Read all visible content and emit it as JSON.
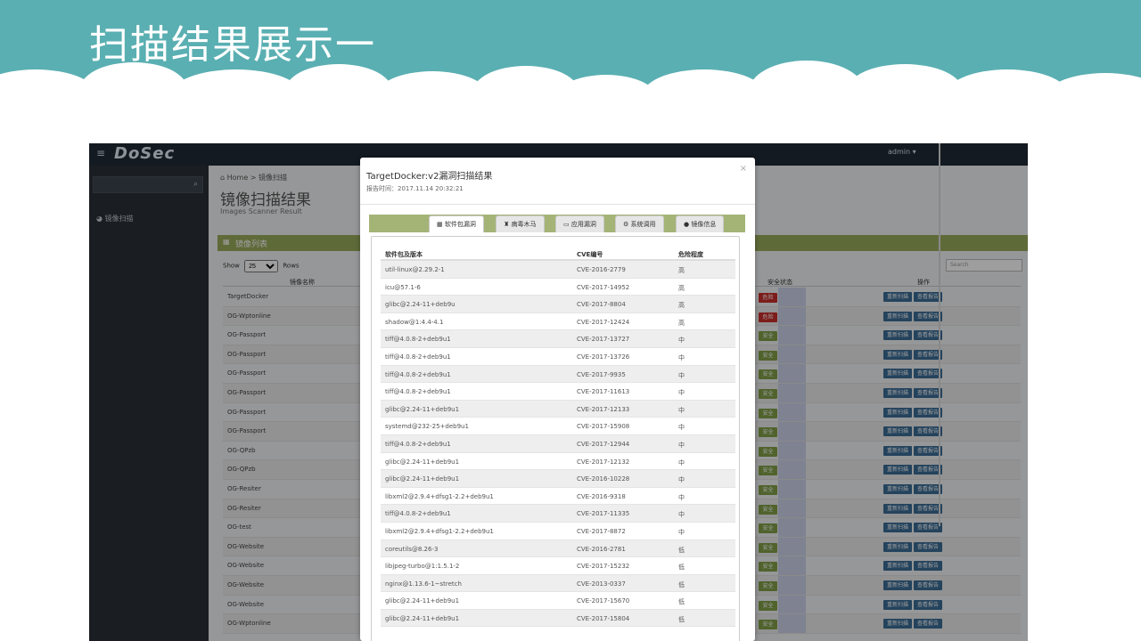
{
  "slide_title": "扫描结果展示一",
  "app": {
    "logo": "DoSec",
    "user": "admin ▾",
    "sidebar": {
      "search_placeholder": "Search...",
      "item": "镜像扫描"
    },
    "breadcrumb": {
      "home": "Home",
      "sep": ">",
      "current": "镜像扫描"
    },
    "page_title": "镜像扫描结果",
    "page_subtitle": "Images Scanner Result",
    "panel_title": "镜像列表",
    "show_label": "Show",
    "show_value": "25",
    "rows_label": "Rows",
    "search_placeholder": "Search",
    "columns": {
      "name": "镜像名称",
      "status": "安全状态",
      "ops": "操作"
    },
    "btn_rescan": "重新扫描",
    "btn_report": "查看报告",
    "images": [
      {
        "name": "TargetDocker",
        "status": "危险",
        "level": "danger"
      },
      {
        "name": "OG-Wptonline",
        "status": "危险",
        "level": "danger"
      },
      {
        "name": "OG-Passport",
        "status": "安全",
        "level": "safe"
      },
      {
        "name": "OG-Passport",
        "status": "安全",
        "level": "safe"
      },
      {
        "name": "OG-Passport",
        "status": "安全",
        "level": "safe"
      },
      {
        "name": "OG-Passport",
        "status": "安全",
        "level": "safe"
      },
      {
        "name": "OG-Passport",
        "status": "安全",
        "level": "safe"
      },
      {
        "name": "OG-Passport",
        "status": "安全",
        "level": "safe"
      },
      {
        "name": "OG-QPzb",
        "status": "安全",
        "level": "safe"
      },
      {
        "name": "OG-QPzb",
        "status": "安全",
        "level": "safe"
      },
      {
        "name": "OG-Resiter",
        "status": "安全",
        "level": "safe"
      },
      {
        "name": "OG-Resiter",
        "status": "安全",
        "level": "safe"
      },
      {
        "name": "OG-test",
        "status": "安全",
        "level": "safe"
      },
      {
        "name": "OG-Website",
        "status": "安全",
        "level": "safe"
      },
      {
        "name": "OG-Website",
        "status": "安全",
        "level": "safe"
      },
      {
        "name": "OG-Website",
        "status": "安全",
        "level": "safe"
      },
      {
        "name": "OG-Website",
        "status": "安全",
        "level": "safe"
      },
      {
        "name": "OG-Wptonline",
        "status": "安全",
        "level": "safe"
      }
    ]
  },
  "modal": {
    "title": "TargetDocker:v2漏洞扫描结果",
    "report_time": "报告时间：2017.11.14 20:32:21",
    "close": "×",
    "tabs": [
      "软件包漏洞",
      "病毒木马",
      "应用漏洞",
      "系统调用",
      "镜像信息"
    ],
    "tab_icons": [
      "▦",
      "♜",
      "▭",
      "⚙",
      "●"
    ],
    "columns": {
      "pkg": "软件包及版本",
      "cve": "CVE编号",
      "severity": "危险程度"
    },
    "vulns": [
      {
        "pkg": "util-linux@2.29.2-1",
        "cve": "CVE-2016-2779",
        "sev": "高"
      },
      {
        "pkg": "icu@57.1-6",
        "cve": "CVE-2017-14952",
        "sev": "高"
      },
      {
        "pkg": "glibc@2.24-11+deb9u",
        "cve": "CVE-2017-8804",
        "sev": "高"
      },
      {
        "pkg": "shadow@1:4.4-4.1",
        "cve": "CVE-2017-12424",
        "sev": "高"
      },
      {
        "pkg": "tiff@4.0.8-2+deb9u1",
        "cve": "CVE-2017-13727",
        "sev": "中"
      },
      {
        "pkg": "tiff@4.0.8-2+deb9u1",
        "cve": "CVE-2017-13726",
        "sev": "中"
      },
      {
        "pkg": "tiff@4.0.8-2+deb9u1",
        "cve": "CVE-2017-9935",
        "sev": "中"
      },
      {
        "pkg": "tiff@4.0.8-2+deb9u1",
        "cve": "CVE-2017-11613",
        "sev": "中"
      },
      {
        "pkg": "glibc@2.24-11+deb9u1",
        "cve": "CVE-2017-12133",
        "sev": "中"
      },
      {
        "pkg": "systemd@232-25+deb9u1",
        "cve": "CVE-2017-15908",
        "sev": "中"
      },
      {
        "pkg": "tiff@4.0.8-2+deb9u1",
        "cve": "CVE-2017-12944",
        "sev": "中"
      },
      {
        "pkg": "glibc@2.24-11+deb9u1",
        "cve": "CVE-2017-12132",
        "sev": "中"
      },
      {
        "pkg": "glibc@2.24-11+deb9u1",
        "cve": "CVE-2016-10228",
        "sev": "中"
      },
      {
        "pkg": "libxml2@2.9.4+dfsg1-2.2+deb9u1",
        "cve": "CVE-2016-9318",
        "sev": "中"
      },
      {
        "pkg": "tiff@4.0.8-2+deb9u1",
        "cve": "CVE-2017-11335",
        "sev": "中"
      },
      {
        "pkg": "libxml2@2.9.4+dfsg1-2.2+deb9u1",
        "cve": "CVE-2017-8872",
        "sev": "中"
      },
      {
        "pkg": "coreutils@8.26-3",
        "cve": "CVE-2016-2781",
        "sev": "低"
      },
      {
        "pkg": "libjpeg-turbo@1:1.5.1-2",
        "cve": "CVE-2017-15232",
        "sev": "低"
      },
      {
        "pkg": "nginx@1.13.6-1~stretch",
        "cve": "CVE-2013-0337",
        "sev": "低"
      },
      {
        "pkg": "glibc@2.24-11+deb9u1",
        "cve": "CVE-2017-15670",
        "sev": "低"
      },
      {
        "pkg": "glibc@2.24-11+deb9u1",
        "cve": "CVE-2017-15804",
        "sev": "低"
      }
    ]
  },
  "colors": {
    "band": "#5aafb2",
    "navbar": "#1f2a38",
    "panel": "#9aab5c",
    "danger": "#c9302c",
    "safe": "#82a04a"
  }
}
